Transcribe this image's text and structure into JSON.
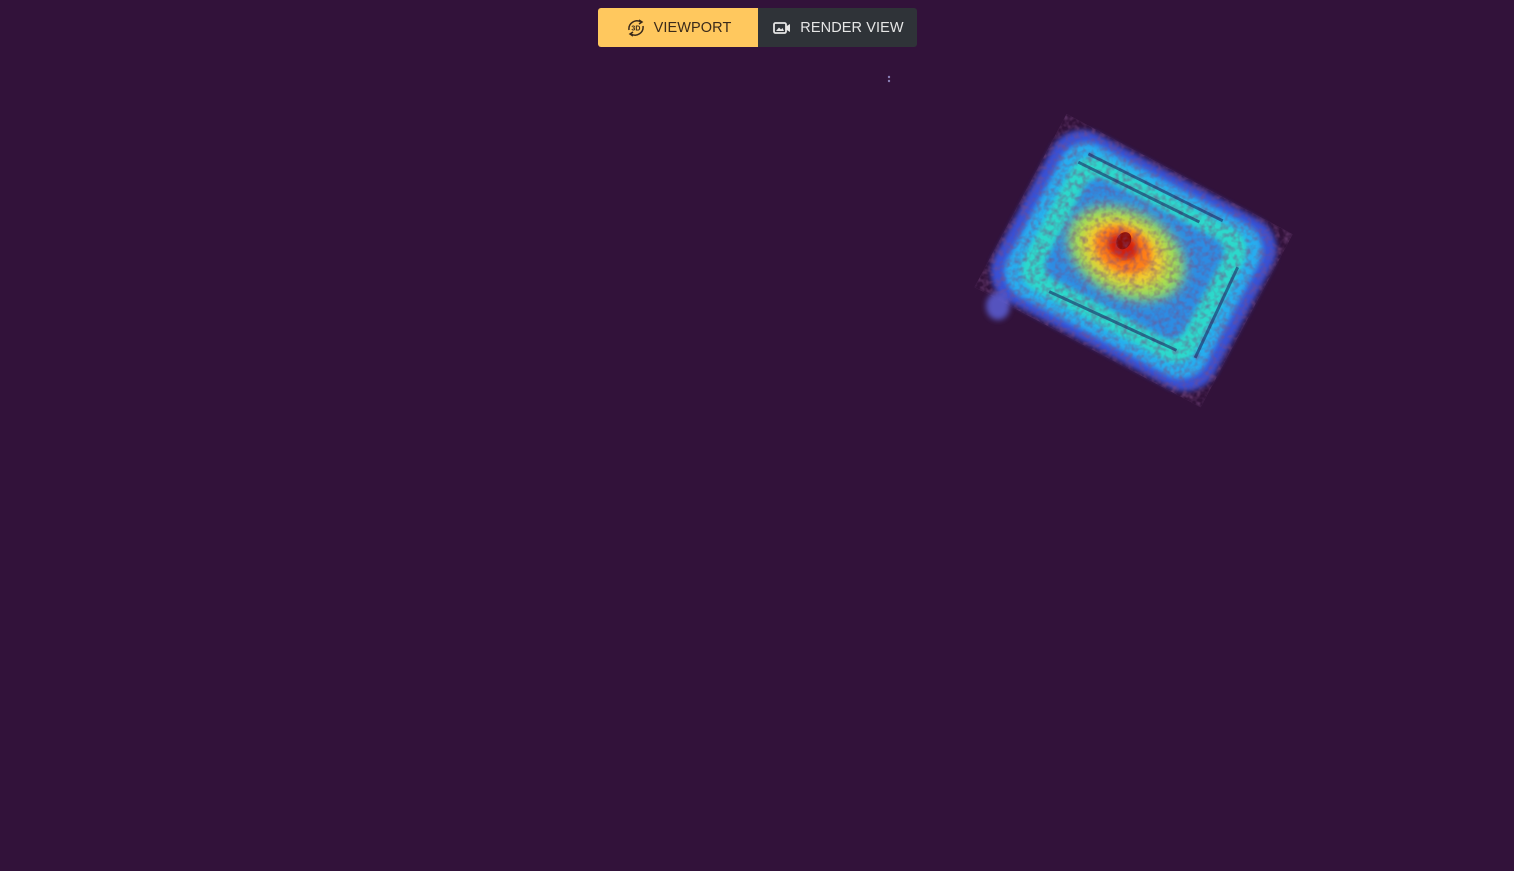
{
  "toolbar": {
    "viewport_label": "VIEWPORT",
    "render_label": "RENDER VIEW",
    "active_mode": "viewport",
    "viewport_icon": "3d-rotate-icon",
    "viewport_icon_text": "3D",
    "render_icon": "video-camera-icon"
  },
  "colors": {
    "background": "#32123a",
    "active_button": "#ffc85e",
    "inactive_button": "#2f3338"
  },
  "scene": {
    "object": "point-cloud",
    "colormap": "turbo"
  }
}
